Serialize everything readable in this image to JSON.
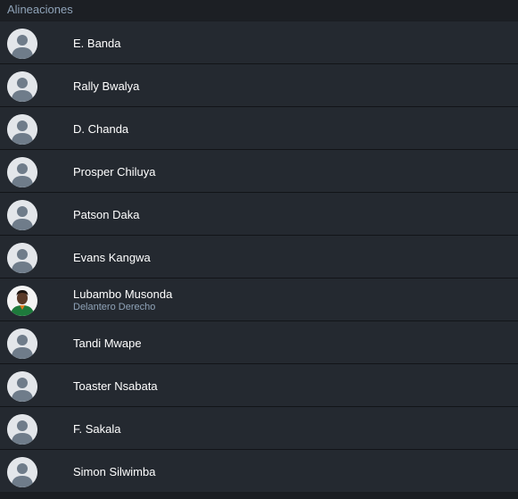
{
  "section": {
    "title": "Alineaciones"
  },
  "players": [
    {
      "name": "E. Banda",
      "role": "",
      "photo": false
    },
    {
      "name": "Rally Bwalya",
      "role": "",
      "photo": false
    },
    {
      "name": "D. Chanda",
      "role": "",
      "photo": false
    },
    {
      "name": "Prosper Chiluya",
      "role": "",
      "photo": false
    },
    {
      "name": "Patson Daka",
      "role": "",
      "photo": false
    },
    {
      "name": "Evans Kangwa",
      "role": "",
      "photo": false
    },
    {
      "name": "Lubambo Musonda",
      "role": "Delantero Derecho",
      "photo": true
    },
    {
      "name": "Tandi Mwape",
      "role": "",
      "photo": false
    },
    {
      "name": "Toaster Nsabata",
      "role": "",
      "photo": false
    },
    {
      "name": "F. Sakala",
      "role": "",
      "photo": false
    },
    {
      "name": "Simon Silwimba",
      "role": "",
      "photo": false
    }
  ],
  "icons": {
    "placeholder": "player-silhouette-icon",
    "photo": "player-photo"
  },
  "colors": {
    "background": "#1a1d22",
    "row": "#242930",
    "name": "#ffffff",
    "role": "#8fa3b8",
    "header": "#8fa3b8"
  }
}
